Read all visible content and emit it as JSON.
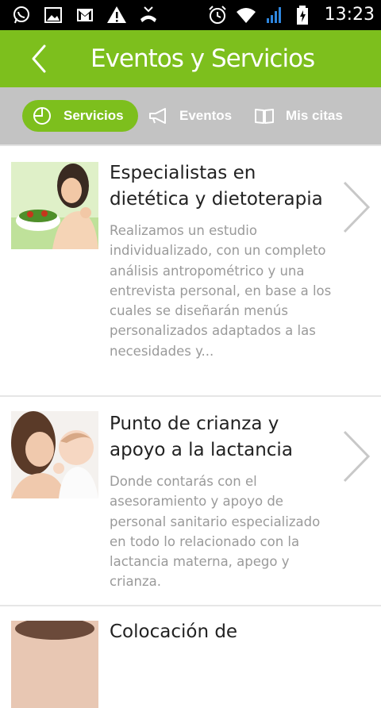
{
  "status_bar": {
    "time": "13:23",
    "left_icons": [
      "whatsapp-icon",
      "gallery-icon",
      "gmail-icon",
      "warning-icon",
      "missed-call-icon"
    ],
    "right_icons": [
      "alarm-icon",
      "wifi-icon",
      "signal-icon",
      "battery-icon"
    ]
  },
  "app_bar": {
    "title": "Eventos y Servicios",
    "color": "#7dbf1d"
  },
  "tabs": [
    {
      "label": "Servicios",
      "icon": "pie-chart-icon",
      "active": true
    },
    {
      "label": "Eventos",
      "icon": "megaphone-icon",
      "active": false
    },
    {
      "label": "Mis citas",
      "icon": "book-icon",
      "active": false
    }
  ],
  "items": [
    {
      "title": "Especialistas en dietética y dietoterapia",
      "description": "Realizamos un estudio individualizado, con un completo análisis antropométrico y una entrevista personal, en base a los cuales se diseñarán menús personalizados adaptados a las necesidades y...",
      "image": "woman-salad-photo"
    },
    {
      "title": "Punto de crianza y apoyo a la lactancia",
      "description": "Donde contarás con el asesoramiento y apoyo de personal sanitario especializado en todo lo relacionado con la lactancia materna, apego y crianza.",
      "image": "mother-baby-photo"
    },
    {
      "title": "Colocación de",
      "description": "",
      "image": "ear-photo"
    }
  ]
}
